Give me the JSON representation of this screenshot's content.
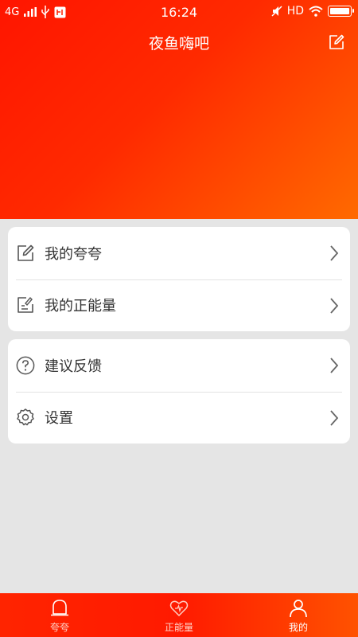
{
  "status_bar": {
    "network": "4G",
    "time": "16:24",
    "hd": "HD"
  },
  "header": {
    "title": "夜鱼嗨吧"
  },
  "menu_group_1": [
    {
      "label": "我的夸夸",
      "icon": "edit-icon"
    },
    {
      "label": "我的正能量",
      "icon": "checklist-icon"
    }
  ],
  "menu_group_2": [
    {
      "label": "建议反馈",
      "icon": "question-icon"
    },
    {
      "label": "设置",
      "icon": "gear-icon"
    }
  ],
  "tabbar": {
    "tabs": [
      {
        "label": "夸夸",
        "icon": "bell-icon",
        "active": false
      },
      {
        "label": "正能量",
        "icon": "heart-icon",
        "active": false
      },
      {
        "label": "我的",
        "icon": "person-icon",
        "active": true
      }
    ]
  },
  "colors": {
    "hero_start": "#ff1500",
    "hero_end": "#ff6a00",
    "background": "#e5e5e5",
    "icon_gray": "#555555"
  }
}
